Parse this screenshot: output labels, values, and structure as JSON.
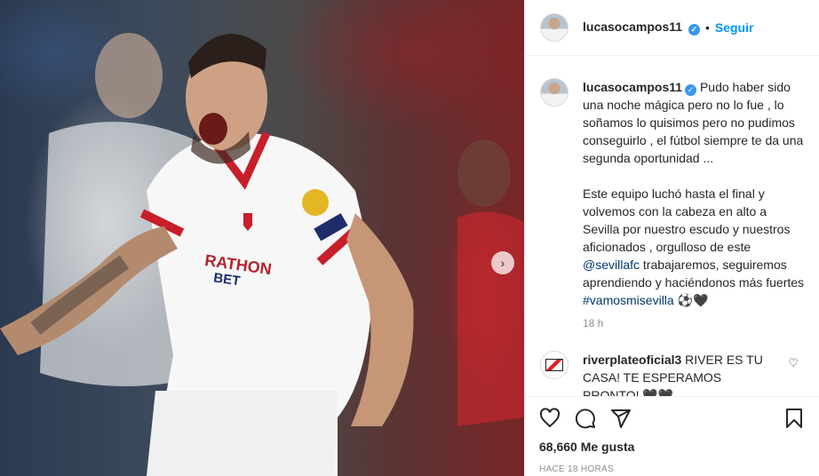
{
  "post": {
    "photo_next": "›",
    "username": "lucasocampos11",
    "verified_mark": "✓",
    "separator": "•",
    "follow_label": "Seguir",
    "caption": {
      "p1": "Pudo haber sido una noche mágica pero no lo fue , lo soñamos lo quisimos pero no pudimos conseguirlo , el fútbol siempre te da una segunda oportunidad ...",
      "p2_start": "Este equipo luchó hasta el final y volvemos con la cabeza en alto a Sevilla por nuestro escudo y nuestros aficionados , orgulloso de este ",
      "mention": "@sevillafc",
      "p2_middle": " trabajaremos, seguiremos aprendiendo y haciéndonos más fuertes ",
      "hashtag": "#vamosmisevilla",
      "p2_end": " ⚽🖤"
    },
    "caption_time": "18 h",
    "comment": {
      "user": "riverplateoficial3",
      "text": " RIVER ES TU CASA! TE ESPERAMOS PRONTO! 🖤🖤"
    },
    "likes": "68,660 Me gusta",
    "posted": "HACE 18 HORAS"
  },
  "icons": {
    "like": "heart-icon",
    "comment": "comment-icon",
    "share": "paper-plane-icon",
    "save": "bookmark-icon",
    "comment_like": "heart-icon"
  },
  "colors": {
    "link": "#00376b",
    "follow": "#0095f6",
    "verified": "#3897f0",
    "muted": "#8e8e8e"
  }
}
